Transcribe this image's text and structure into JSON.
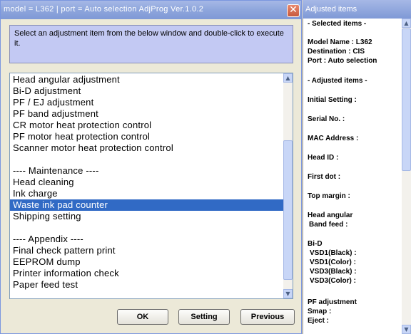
{
  "window": {
    "title": "model = L362  |  port = Auto selection     AdjProg Ver.1.0.2",
    "close_glyph": "✕"
  },
  "instruction": "Select an adjustment item from the below window and double-click to execute it.",
  "list_items": [
    {
      "label": "Head angular adjustment",
      "selected": false
    },
    {
      "label": "Bi-D adjustment",
      "selected": false
    },
    {
      "label": "PF / EJ adjustment",
      "selected": false
    },
    {
      "label": "PF band adjustment",
      "selected": false
    },
    {
      "label": "CR motor heat protection control",
      "selected": false
    },
    {
      "label": "PF motor heat protection control",
      "selected": false
    },
    {
      "label": "Scanner motor heat protection control",
      "selected": false
    },
    {
      "label": "",
      "selected": false
    },
    {
      "label": "---- Maintenance ----",
      "selected": false
    },
    {
      "label": "Head cleaning",
      "selected": false
    },
    {
      "label": "Ink charge",
      "selected": false
    },
    {
      "label": "Waste ink pad counter",
      "selected": true
    },
    {
      "label": "Shipping setting",
      "selected": false
    },
    {
      "label": "",
      "selected": false
    },
    {
      "label": "---- Appendix ----",
      "selected": false
    },
    {
      "label": "Final check pattern print",
      "selected": false
    },
    {
      "label": "EEPROM dump",
      "selected": false
    },
    {
      "label": "Printer information check",
      "selected": false
    },
    {
      "label": "Paper feed test",
      "selected": false
    }
  ],
  "buttons": {
    "ok": "OK",
    "setting": "Setting",
    "previous": "Previous"
  },
  "side_panel": {
    "title": "Adjusted items",
    "selected_header": "- Selected items -",
    "model_name": "Model Name : L362",
    "destination": "Destination : CIS",
    "port": "Port : Auto selection",
    "adjusted_header": "- Adjusted items -",
    "initial_setting": "Initial Setting :",
    "serial_no": "Serial No. :",
    "mac_address": "MAC Address :",
    "head_id": "Head ID :",
    "first_dot": "First dot :",
    "top_margin": "Top margin :",
    "head_angular": "Head angular",
    "band_feed": "Band feed :",
    "bi_d": "Bi-D",
    "vsd1_black": "VSD1(Black) :",
    "vsd1_color": "VSD1(Color) :",
    "vsd3_black": "VSD3(Black) :",
    "vsd3_color": "VSD3(Color) :",
    "pf_adjustment": "PF adjustment",
    "smap": "Smap :",
    "eject": "Eject :"
  },
  "colors": {
    "selection": "#316ac5",
    "instruction_bg": "#c3c9f3",
    "titlebar": "#8ea6dc"
  }
}
